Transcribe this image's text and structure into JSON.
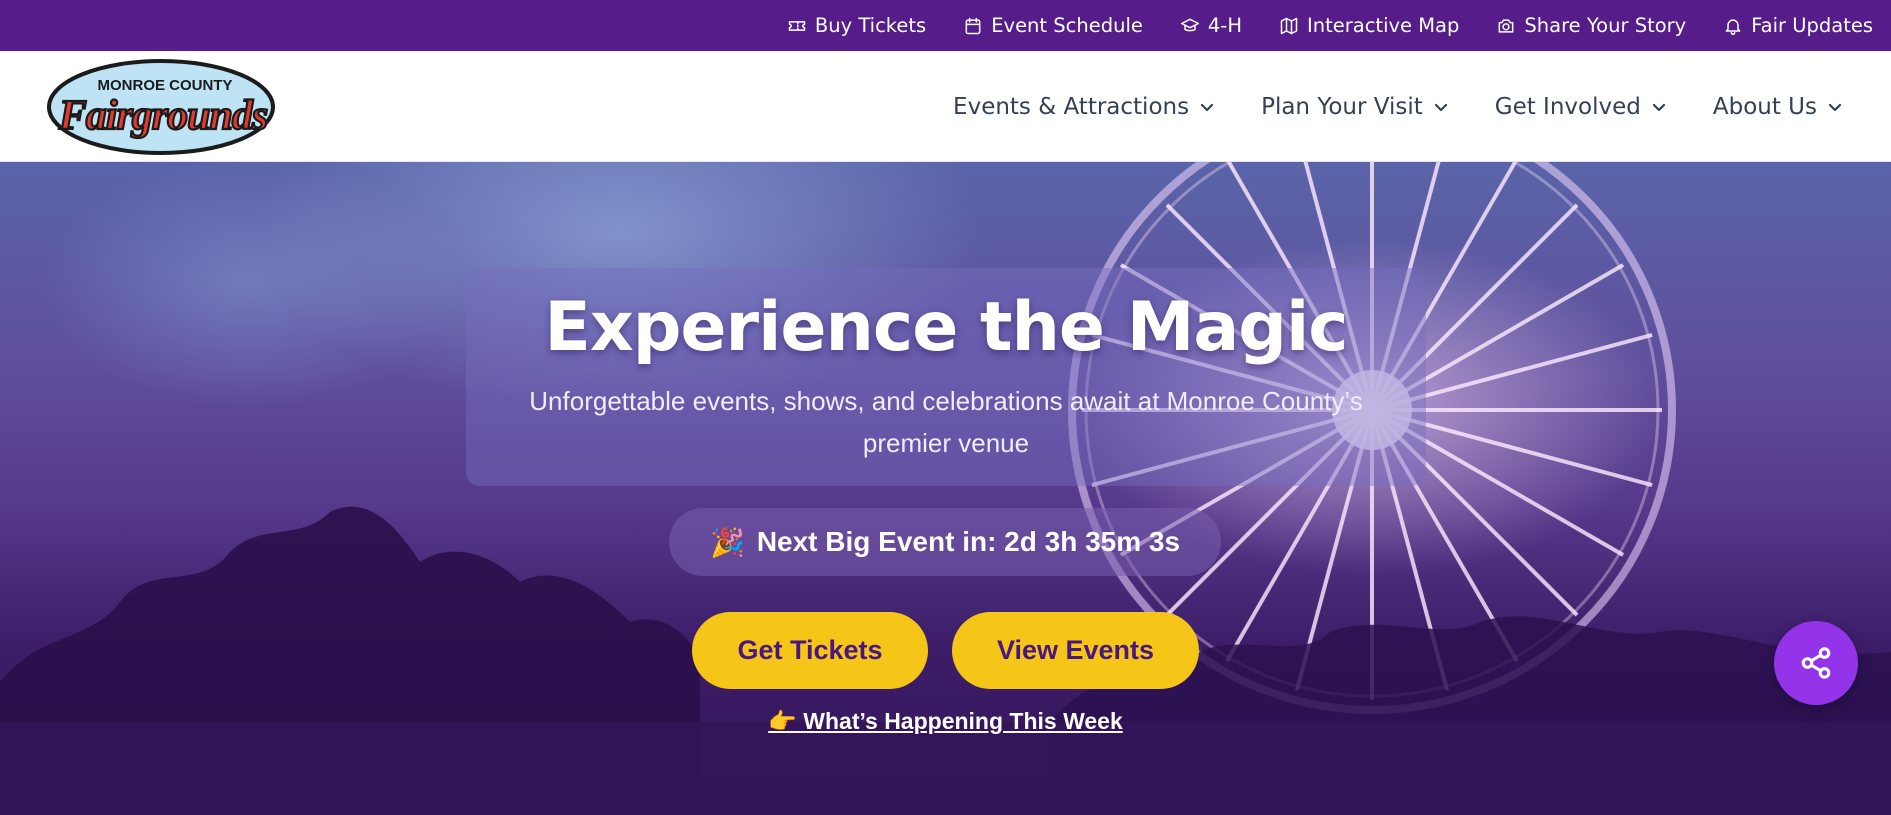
{
  "topbar": {
    "links": [
      {
        "label": "Buy Tickets",
        "icon": "ticket-icon"
      },
      {
        "label": "Event Schedule",
        "icon": "calendar-icon"
      },
      {
        "label": "4-H",
        "icon": "graduation-cap-icon"
      },
      {
        "label": "Interactive Map",
        "icon": "map-icon"
      },
      {
        "label": "Share Your Story",
        "icon": "camera-icon"
      },
      {
        "label": "Fair Updates",
        "icon": "bell-icon"
      }
    ],
    "background": "#561d8a"
  },
  "header": {
    "logo": {
      "top_text": "MONROE COUNTY",
      "main_text": "Fairgrounds"
    },
    "nav": [
      {
        "label": "Events & Attractions"
      },
      {
        "label": "Plan Your Visit"
      },
      {
        "label": "Get Involved"
      },
      {
        "label": "About Us"
      }
    ]
  },
  "hero": {
    "title": "Experience the Magic",
    "subtitle": "Unforgettable events, shows, and celebrations await at Monroe County’s premier venue",
    "countdown": {
      "emoji": "🎉",
      "text": "Next Big Event in: 2d 3h 35m 3s"
    },
    "buttons": {
      "tickets": "Get Tickets",
      "events": "View Events"
    },
    "week_link": {
      "emoji": "👉",
      "text": "What’s Happening This Week"
    }
  },
  "share_button": {
    "icon": "share-icon"
  },
  "colors": {
    "accent_yellow": "#f5c518",
    "brand_purple": "#561d8a",
    "fab_purple": "#9333ea"
  }
}
